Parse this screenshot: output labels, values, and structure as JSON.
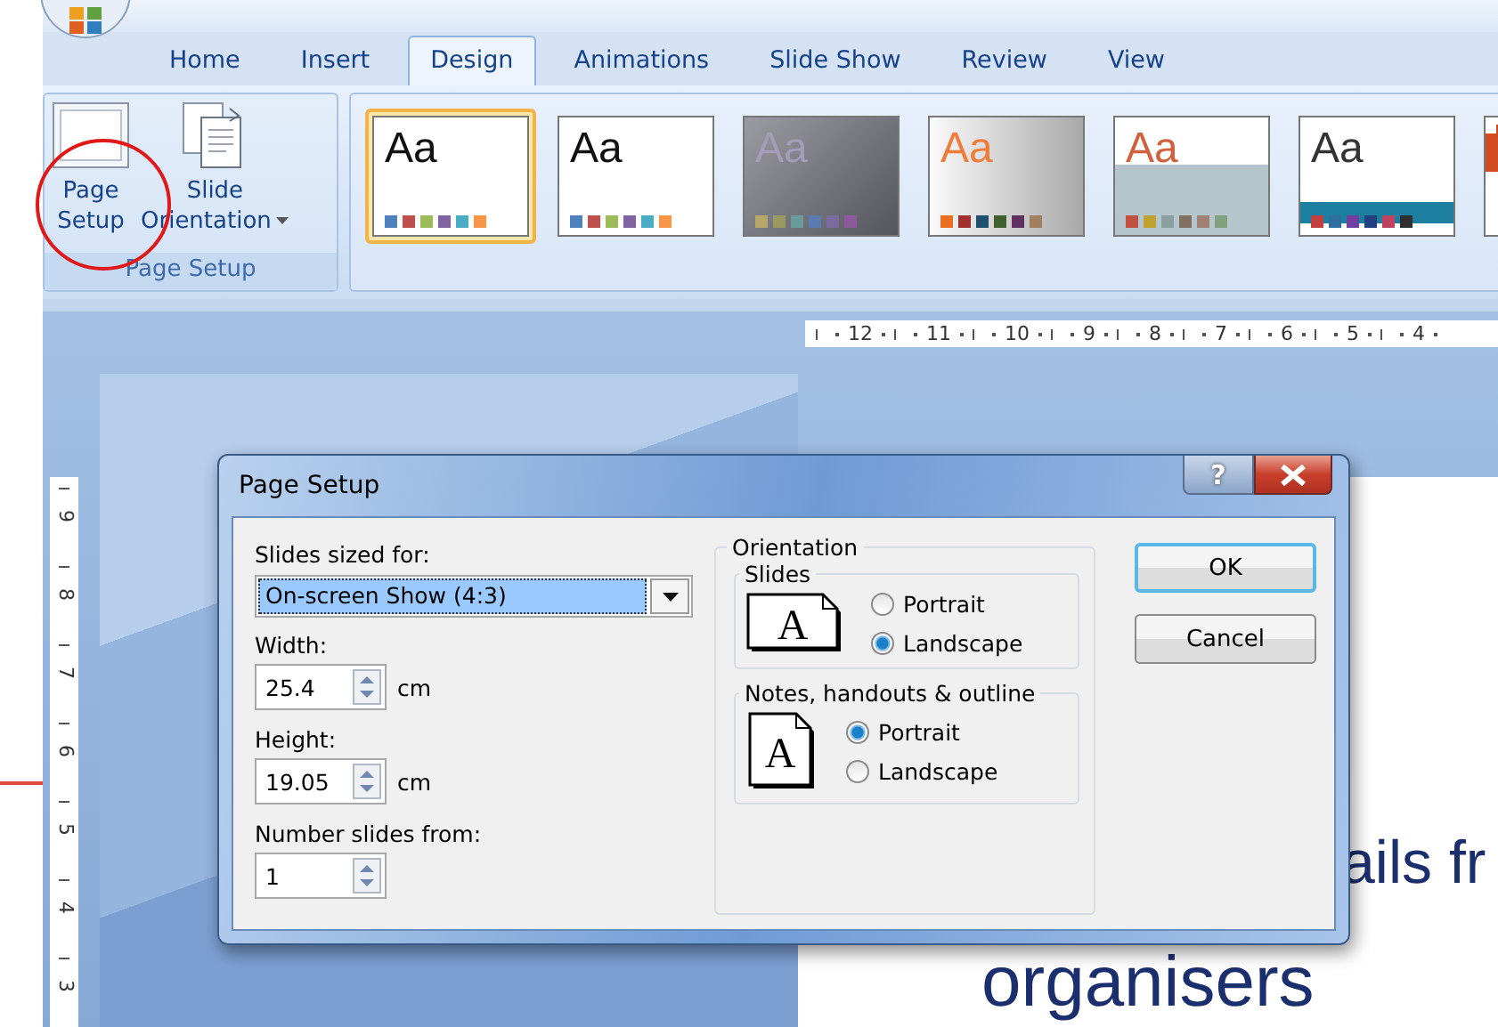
{
  "tabs": [
    {
      "label": "Home",
      "selected": false
    },
    {
      "label": "Insert",
      "selected": false
    },
    {
      "label": "Design",
      "selected": true
    },
    {
      "label": "Animations",
      "selected": false
    },
    {
      "label": "Slide Show",
      "selected": false
    },
    {
      "label": "Review",
      "selected": false
    },
    {
      "label": "View",
      "selected": false
    }
  ],
  "ribbon": {
    "group": {
      "buttons": [
        {
          "lines": [
            "Page",
            "Setup"
          ],
          "kind": "page",
          "dropdown": false
        },
        {
          "lines": [
            "Slide",
            "Orientation"
          ],
          "kind": "pages",
          "dropdown": true
        }
      ],
      "label": "Page Setup"
    },
    "themes": [
      {
        "label": "Aa",
        "kind": "plain",
        "selected": true,
        "color": "#111111",
        "swatches": [
          {
            "color": "#4f81bd"
          },
          {
            "color": "#c0504d"
          },
          {
            "color": "#9bbb59"
          },
          {
            "color": "#8064a2"
          },
          {
            "color": "#4bacc6"
          },
          {
            "color": "#f79646"
          }
        ]
      },
      {
        "label": "Aa",
        "kind": "plain",
        "selected": false,
        "color": "#111111",
        "swatches": [
          {
            "color": "#4f81bd"
          },
          {
            "color": "#c0504d"
          },
          {
            "color": "#9bbb59"
          },
          {
            "color": "#8064a2"
          },
          {
            "color": "#4bacc6"
          },
          {
            "color": "#f79646"
          }
        ]
      },
      {
        "label": "Aa",
        "kind": "dark",
        "selected": false,
        "color": "#a49cb8",
        "swatches": [
          {
            "color": "#b5a66a"
          },
          {
            "color": "#9a9a60"
          },
          {
            "color": "#6a9a9a"
          },
          {
            "color": "#5a7ab0"
          },
          {
            "color": "#7a6aa0"
          },
          {
            "color": "#8a5a9a"
          }
        ]
      },
      {
        "label": "Aa",
        "kind": "silver",
        "selected": false,
        "color": "#f07c3a",
        "swatches": [
          {
            "color": "#e87020"
          },
          {
            "color": "#a03030"
          },
          {
            "color": "#205070"
          },
          {
            "color": "#406030"
          },
          {
            "color": "#603060"
          },
          {
            "color": "#a08060"
          }
        ]
      },
      {
        "label": "Aa",
        "kind": "slate",
        "selected": false,
        "color": "#d0603e",
        "swatches": [
          {
            "color": "#c05040"
          },
          {
            "color": "#c0a030"
          },
          {
            "color": "#8aa0a0"
          },
          {
            "color": "#807060"
          },
          {
            "color": "#a08070"
          },
          {
            "color": "#80a080"
          }
        ]
      },
      {
        "label": "Aa",
        "kind": "wave",
        "selected": false,
        "color": "#333333",
        "swatches": [
          {
            "color": "#c04040"
          },
          {
            "color": "#3070a0"
          },
          {
            "color": "#7040a0"
          },
          {
            "color": "#204080"
          },
          {
            "color": "#c04060"
          },
          {
            "color": "#303030"
          }
        ]
      },
      {
        "kind": "banner",
        "selected": false,
        "swatches": [
          {
            "color": "#d04a20"
          }
        ]
      }
    ]
  },
  "rulers": {
    "horizontal": [
      "12",
      "11",
      "10",
      "9",
      "8",
      "7",
      "6",
      "5",
      "4"
    ],
    "vertical": [
      "9",
      "8",
      "7",
      "6",
      "5",
      "4",
      "3"
    ]
  },
  "slide": {
    "lines": [
      "ails fr",
      "organisers"
    ]
  },
  "dialog": {
    "title": "Page Setup",
    "help": "?",
    "size_label": "Slides sized for:",
    "size_value": "On-screen Show (4:3)",
    "fields": [
      {
        "label": "Width:",
        "value": "25.4",
        "unit": "cm"
      },
      {
        "label": "Height:",
        "value": "19.05",
        "unit": "cm"
      },
      {
        "label": "Number slides from:",
        "value": "1"
      }
    ],
    "orientation": {
      "title": "Orientation",
      "groups": [
        {
          "title": "Slides",
          "kind": "landscape",
          "letter": "A",
          "options": [
            {
              "label": "Portrait",
              "selected": false
            },
            {
              "label": "Landscape",
              "selected": true
            }
          ]
        },
        {
          "title": "Notes, handouts & outline",
          "kind": "portrait",
          "letter": "A",
          "options": [
            {
              "label": "Portrait",
              "selected": true
            },
            {
              "label": "Landscape",
              "selected": false
            }
          ]
        }
      ]
    },
    "buttons": [
      {
        "label": "OK",
        "default": true
      },
      {
        "label": "Cancel",
        "default": false
      }
    ]
  }
}
